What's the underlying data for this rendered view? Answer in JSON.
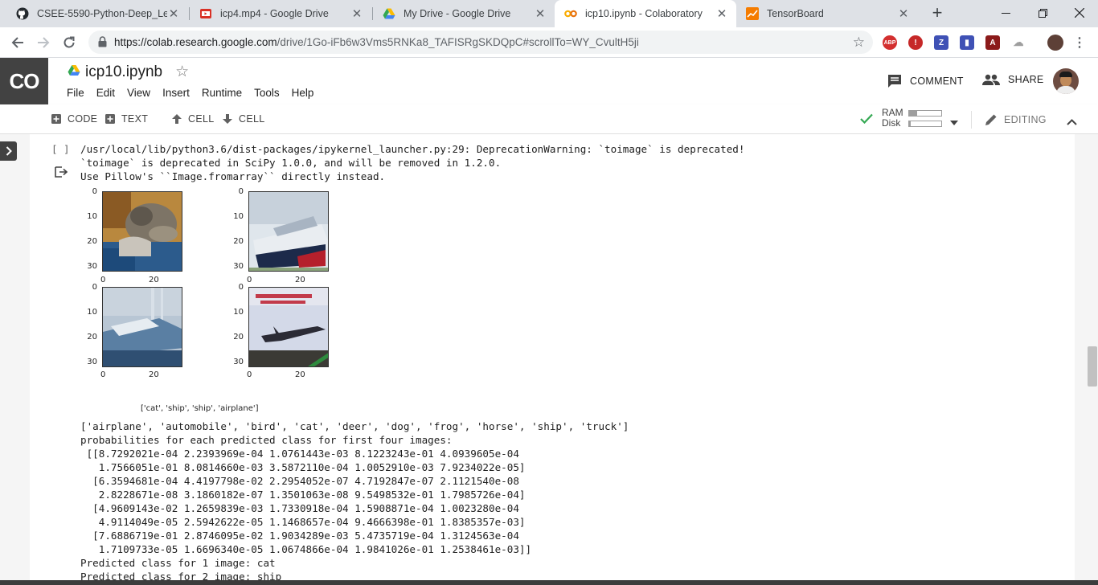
{
  "browser": {
    "tabs": [
      {
        "title": "CSEE-5590-Python-Deep_Learning",
        "icon": "github-icon"
      },
      {
        "title": "icp4.mp4 - Google Drive",
        "icon": "video-icon"
      },
      {
        "title": "My Drive - Google Drive",
        "icon": "google-drive-icon"
      },
      {
        "title": "icp10.ipynb - Colaboratory",
        "icon": "colab-icon",
        "active": true
      },
      {
        "title": "TensorBoard",
        "icon": "tensorboard-icon"
      }
    ],
    "url_host": "https://colab.research.google.com",
    "url_path": "/drive/1Go-iFb6w3Vms5RNKa8_TAFISRgSKDQpC#scrollTo=WY_CvultH5ji"
  },
  "colab": {
    "logo": "CO",
    "notebook_title": "icp10.ipynb",
    "menu": [
      "File",
      "Edit",
      "View",
      "Insert",
      "Runtime",
      "Tools",
      "Help"
    ],
    "comment_label": "COMMENT",
    "share_label": "SHARE",
    "toolbar": {
      "add_code": "CODE",
      "add_text": "TEXT",
      "cell_up": "CELL",
      "cell_down": "CELL",
      "ram_label": "RAM",
      "disk_label": "Disk",
      "ram_usage": 0.25,
      "disk_usage": 0.05,
      "editing_label": "EDITING"
    }
  },
  "cell": {
    "run_indicator": "[ ]",
    "output_lines_top": [
      "/usr/local/lib/python3.6/dist-packages/ipykernel_launcher.py:29: DeprecationWarning: `toimage` is deprecated!",
      "`toimage` is deprecated in SciPy 1.0.0, and will be removed in 1.2.0.",
      "Use Pillow's ``Image.fromarray`` directly instead."
    ],
    "plot_y_ticks": [
      "0",
      "10",
      "20",
      "30"
    ],
    "plot_x_ticks": [
      "0",
      "20"
    ],
    "image_labels": "['cat', 'ship', 'ship', 'airplane']",
    "output_lines_bottom": [
      "['airplane', 'automobile', 'bird', 'cat', 'deer', 'dog', 'frog', 'horse', 'ship', 'truck']",
      "probabilities for each predicted class for first four images:",
      " [[8.7292021e-04 2.2393969e-04 1.0761443e-03 8.1223243e-01 4.0939605e-04",
      "   1.7566051e-01 8.0814660e-03 3.5872110e-04 1.0052910e-03 7.9234022e-05]",
      "  [6.3594681e-04 4.4197798e-02 2.2954052e-07 4.7192847e-07 2.1121540e-08",
      "   2.8228671e-08 3.1860182e-07 1.3501063e-08 9.5498532e-01 1.7985726e-04]",
      "  [4.9609143e-02 1.2659839e-03 1.7330918e-04 1.5908871e-04 1.0023280e-04",
      "   4.9114049e-05 2.5942622e-05 1.1468657e-04 9.4666398e-01 1.8385357e-03]",
      "  [7.6886719e-01 2.8746095e-02 1.9034289e-03 5.4735719e-04 1.3124563e-04",
      "   1.7109733e-05 1.6696340e-05 1.0674866e-04 1.9841026e-01 1.2538461e-03]]",
      "Predicted class for 1 image: cat",
      "Predicted class for 2 image: ship"
    ]
  }
}
